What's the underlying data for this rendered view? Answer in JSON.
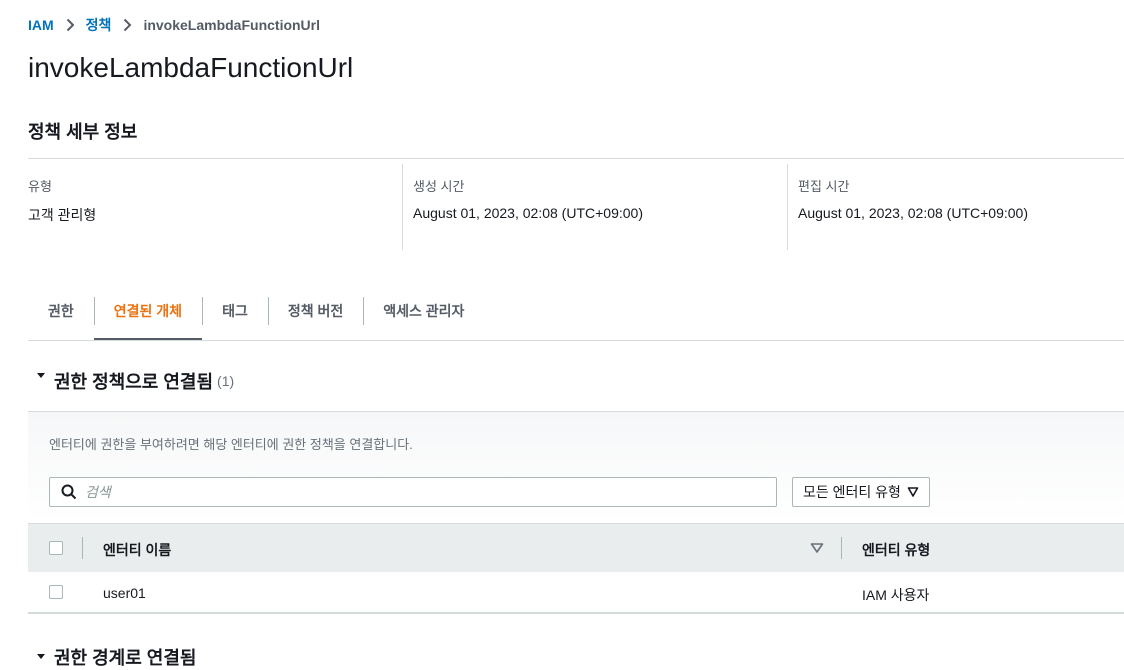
{
  "breadcrumb": {
    "items": [
      {
        "label": "IAM"
      },
      {
        "label": "정책"
      }
    ],
    "current": "invokeLambdaFunctionUrl"
  },
  "page_title": "invokeLambdaFunctionUrl",
  "details": {
    "title": "정책 세부 정보",
    "fields": [
      {
        "label": "유형",
        "value": "고객 관리형"
      },
      {
        "label": "생성 시간",
        "value": "August 01, 2023, 02:08 (UTC+09:00)"
      },
      {
        "label": "편집 시간",
        "value": "August 01, 2023, 02:08 (UTC+09:00)"
      }
    ]
  },
  "tabs": [
    {
      "label": "권한",
      "active": false
    },
    {
      "label": "연결된 개체",
      "active": true
    },
    {
      "label": "태그",
      "active": false
    },
    {
      "label": "정책 버전",
      "active": false
    },
    {
      "label": "액세스 관리자",
      "active": false
    }
  ],
  "attached_section": {
    "title": "권한 정책으로 연결됨",
    "count": "(1)",
    "description": "엔터티에 권한을 부여하려면 해당 엔터티에 권한 정책을 연결합니다.",
    "search": {
      "placeholder": "검색",
      "value": ""
    },
    "filter": {
      "label": "모든 엔터티 유형"
    },
    "table": {
      "columns": [
        "엔터티 이름",
        "엔터티 유형"
      ],
      "rows": [
        {
          "name": "user01",
          "type": "IAM 사용자"
        }
      ]
    }
  },
  "next_section": {
    "title": "권한 경계로 연결됨"
  },
  "colors": {
    "link": "#0073bb",
    "active_tab": "#ec7211",
    "text": "#16191f",
    "muted": "#545b64"
  },
  "icons": {
    "breadcrumb_separator": "chevron-right-icon",
    "section_toggle": "caret-down-icon",
    "search": "search-icon",
    "filter": "triangle-down-icon",
    "sort": "sort-down-icon"
  }
}
